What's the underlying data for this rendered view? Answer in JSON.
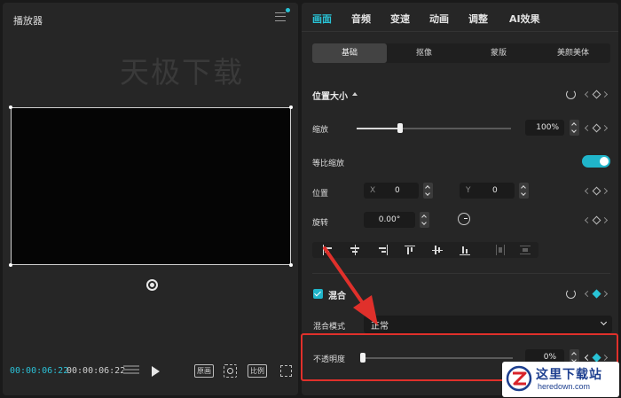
{
  "player": {
    "title": "播放器",
    "watermark": "天极下载",
    "time_current": "00:00:06:22",
    "time_total": "00:00:06:22",
    "preview_label": "原画",
    "ratio_label": "比例"
  },
  "main_tabs": [
    "画面",
    "音频",
    "变速",
    "动画",
    "调整",
    "AI效果"
  ],
  "sub_tabs": [
    "基础",
    "抠像",
    "蒙版",
    "美颜美体"
  ],
  "position_size": {
    "section_label": "位置大小",
    "scale_label": "缩放",
    "scale_value": "100%",
    "scale_fraction": 0.28,
    "uniform_label": "等比缩放",
    "uniform_on": true,
    "position_label": "位置",
    "x_label": "X",
    "x_value": "0",
    "y_label": "Y",
    "y_value": "0",
    "rotation_label": "旋转",
    "rotation_value": "0.00°"
  },
  "blend": {
    "section_label": "混合",
    "enabled": true,
    "mode_label": "混合模式",
    "mode_value": "正常",
    "opacity_label": "不透明度",
    "opacity_value": "0%",
    "opacity_fraction": 0.0
  },
  "site_watermark": {
    "name": "这里下载站",
    "domain": "heredown.com"
  },
  "colors": {
    "accent": "#29c3d6",
    "annotation": "#e0302b",
    "panel": "#262626"
  }
}
